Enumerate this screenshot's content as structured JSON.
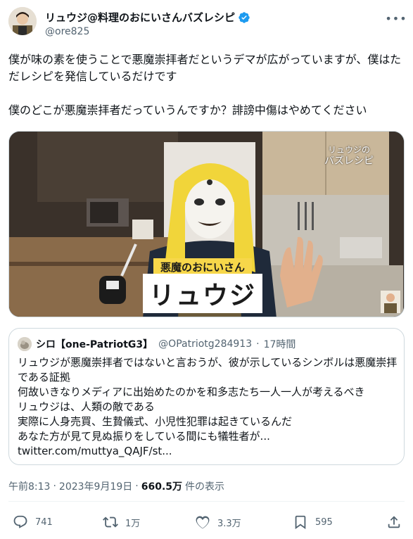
{
  "author": {
    "display_name": "リュウジ@料理のおにいさんバズレシピ",
    "handle": "@ore825",
    "verified": true,
    "verified_color": "#1d9bf0"
  },
  "tweet": {
    "text": "僕が味の素を使うことで悪魔崇拝者だというデマが広がっていますが、僕はただレシピを発信しているだけです\n\n僕のどこが悪魔崇拝者だっていうんですか？誹謗中傷はやめてください"
  },
  "media": {
    "watermark_line1": "リュウジの",
    "watermark_line2": "バズレシピ",
    "caption_small": "悪魔のおにいさん",
    "caption_large": "リュウジ"
  },
  "quote": {
    "display_name": "シロ【one-PatriotG3】",
    "handle": "@OPatriotg284913",
    "separator": "·",
    "time": "17時間",
    "text": "リュウジが悪魔崇拝者ではないと言おうが、彼が示しているシンボルは悪魔崇拝である証拠\n何故いきなりメディアに出始めたのかを和多志たち一人一人が考えるべき\nリュウジは、人類の敵である\n実際に人身売買、生贄儀式、小児性犯罪は起きているんだ\nあなた方が見て見ぬ振りをしている間にも犠牲者が...\ntwitter.com/muttya_QAJF/st..."
  },
  "meta": {
    "time": "午前8:13",
    "separator": "·",
    "date": "2023年9月19日",
    "views_count": "660.5万",
    "views_label": "件の表示"
  },
  "actions": {
    "reply_count": "741",
    "retweet_count": "1万",
    "like_count": "3.3万",
    "bookmark_count": "595"
  },
  "icons": {
    "more": "more-icon",
    "reply": "reply-icon",
    "retweet": "retweet-icon",
    "like": "heart-icon",
    "bookmark": "bookmark-icon",
    "share": "share-icon"
  }
}
